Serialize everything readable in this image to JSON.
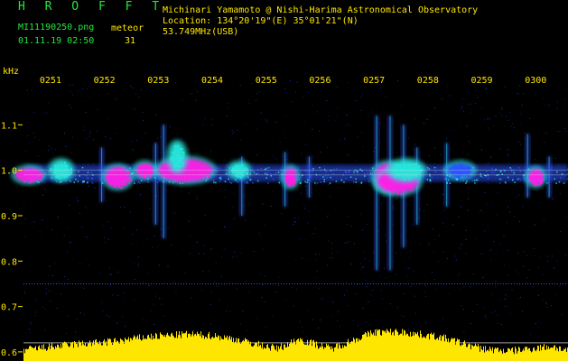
{
  "header": {
    "brand": "H R O F F T",
    "filename": "MI11190250.png",
    "datetime": "01.11.19 02:50",
    "meteor_label": "meteor",
    "meteor_count": "31",
    "observer": "Michinari Yamamoto @ Nishi-Harima Astronomical Observatory",
    "location": "Location: 134°20'19\"(E) 35°01'21\"(N)",
    "frequency": "53.749MHz(USB)"
  },
  "colors": {
    "background": "#000000",
    "text_green": "#22e83a",
    "text_yellow": "#ffe600",
    "signal_strong": "#ff1ee6",
    "signal_mid": "#28e6dc",
    "signal_weak": "#2a52ff",
    "reference_line": "#dcdcdc",
    "dotted_line": "#3a52ff"
  },
  "chart_data": {
    "type": "heatmap",
    "title": "",
    "xlabel": "",
    "ylabel": "kHz",
    "x_ticks": [
      "0251",
      "0252",
      "0253",
      "0254",
      "0255",
      "0256",
      "0257",
      "0258",
      "0259",
      "0300"
    ],
    "y_ticks": [
      "1.1",
      "1.0",
      "0.9",
      "0.8",
      "0.7",
      "0.6"
    ],
    "y_tick_values": [
      1.1,
      1.0,
      0.9,
      0.8,
      0.7,
      0.6
    ],
    "ylim": [
      0.58,
      1.2
    ],
    "xlim_minutes": [
      50.5,
      60.6
    ],
    "reference_lines_khz": [
      1.0,
      0.99,
      0.75,
      0.62
    ],
    "echo_events": [
      {
        "t": 50.6,
        "f": 0.99,
        "width_min": 0.5,
        "height_khz": 0.03,
        "intensity": "strong"
      },
      {
        "t": 51.2,
        "f": 1.0,
        "width_min": 0.35,
        "height_khz": 0.04,
        "intensity": "mid"
      },
      {
        "t": 52.25,
        "f": 0.985,
        "width_min": 0.45,
        "height_khz": 0.045,
        "intensity": "strong"
      },
      {
        "t": 52.75,
        "f": 1.0,
        "width_min": 0.3,
        "height_khz": 0.03,
        "intensity": "strong"
      },
      {
        "t": 53.5,
        "f": 1.0,
        "width_min": 1.0,
        "height_khz": 0.05,
        "intensity": "strong"
      },
      {
        "t": 53.35,
        "f": 1.03,
        "width_min": 0.25,
        "height_khz": 0.06,
        "intensity": "mid"
      },
      {
        "t": 54.5,
        "f": 1.0,
        "width_min": 0.3,
        "height_khz": 0.03,
        "intensity": "mid"
      },
      {
        "t": 55.45,
        "f": 0.985,
        "width_min": 0.2,
        "height_khz": 0.04,
        "intensity": "strong"
      },
      {
        "t": 57.25,
        "f": 0.985,
        "width_min": 0.45,
        "height_khz": 0.06,
        "intensity": "strong"
      },
      {
        "t": 57.45,
        "f": 0.975,
        "width_min": 0.75,
        "height_khz": 0.05,
        "intensity": "strong"
      },
      {
        "t": 57.6,
        "f": 1.0,
        "width_min": 0.6,
        "height_khz": 0.04,
        "intensity": "mid"
      },
      {
        "t": 58.6,
        "f": 1.0,
        "width_min": 0.45,
        "height_khz": 0.03,
        "intensity": "weak"
      },
      {
        "t": 60.0,
        "f": 0.985,
        "width_min": 0.25,
        "height_khz": 0.035,
        "intensity": "strong"
      }
    ],
    "spikes": [
      {
        "t": 51.95,
        "f_low": 0.93,
        "f_high": 1.05
      },
      {
        "t": 52.95,
        "f_low": 0.88,
        "f_high": 1.06
      },
      {
        "t": 53.1,
        "f_low": 0.85,
        "f_high": 1.1
      },
      {
        "t": 54.55,
        "f_low": 0.9,
        "f_high": 1.03
      },
      {
        "t": 55.35,
        "f_low": 0.92,
        "f_high": 1.04
      },
      {
        "t": 55.8,
        "f_low": 0.94,
        "f_high": 1.03
      },
      {
        "t": 57.05,
        "f_low": 0.78,
        "f_high": 1.12
      },
      {
        "t": 57.3,
        "f_low": 0.78,
        "f_high": 1.12
      },
      {
        "t": 57.55,
        "f_low": 0.83,
        "f_high": 1.1
      },
      {
        "t": 57.8,
        "f_low": 0.88,
        "f_high": 1.05
      },
      {
        "t": 58.35,
        "f_low": 0.92,
        "f_high": 1.06
      },
      {
        "t": 59.85,
        "f_low": 0.94,
        "f_high": 1.08
      },
      {
        "t": 60.25,
        "f_low": 0.94,
        "f_high": 1.03
      }
    ],
    "noise_floor": [
      {
        "t": 50.5,
        "level": 0.15
      },
      {
        "t": 51.5,
        "level": 0.4
      },
      {
        "t": 52.2,
        "level": 0.5
      },
      {
        "t": 52.8,
        "level": 0.7
      },
      {
        "t": 53.5,
        "level": 0.8
      },
      {
        "t": 54.0,
        "level": 0.75
      },
      {
        "t": 54.4,
        "level": 0.6
      },
      {
        "t": 55.2,
        "level": 0.2
      },
      {
        "t": 55.6,
        "level": 0.6
      },
      {
        "t": 56.2,
        "level": 0.2
      },
      {
        "t": 57.0,
        "level": 0.9
      },
      {
        "t": 57.5,
        "level": 0.9
      },
      {
        "t": 58.2,
        "level": 0.7
      },
      {
        "t": 59.0,
        "level": 0.2
      },
      {
        "t": 59.5,
        "level": 0.1
      },
      {
        "t": 60.3,
        "level": 0.3
      },
      {
        "t": 60.6,
        "level": 0.1
      }
    ]
  }
}
